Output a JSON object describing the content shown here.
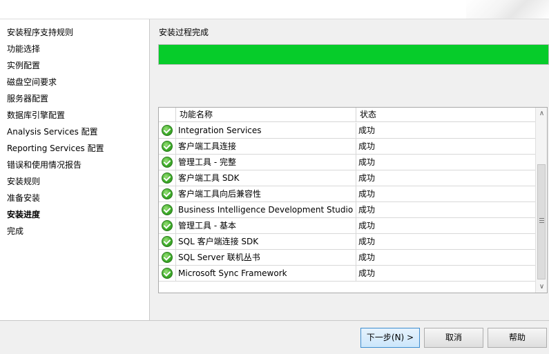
{
  "sidebar": {
    "items": [
      {
        "label": "安装程序支持规则",
        "active": false
      },
      {
        "label": "功能选择",
        "active": false
      },
      {
        "label": "实例配置",
        "active": false
      },
      {
        "label": "磁盘空间要求",
        "active": false
      },
      {
        "label": "服务器配置",
        "active": false
      },
      {
        "label": "数据库引擎配置",
        "active": false
      },
      {
        "label": "Analysis Services 配置",
        "active": false
      },
      {
        "label": "Reporting Services 配置",
        "active": false
      },
      {
        "label": "错误和使用情况报告",
        "active": false
      },
      {
        "label": "安装规则",
        "active": false
      },
      {
        "label": "准备安装",
        "active": false
      },
      {
        "label": "安装进度",
        "active": true
      },
      {
        "label": "完成",
        "active": false
      }
    ]
  },
  "main": {
    "status_text": "安装过程完成",
    "progress_fraction": 1.0,
    "progress_color": "#06cc2a",
    "table": {
      "columns": [
        "功能名称",
        "状态"
      ],
      "rows": [
        {
          "icon": "success-check-icon",
          "name": "Integration Services",
          "status": "成功"
        },
        {
          "icon": "success-check-icon",
          "name": "客户端工具连接",
          "status": "成功"
        },
        {
          "icon": "success-check-icon",
          "name": "管理工具 - 完整",
          "status": "成功"
        },
        {
          "icon": "success-check-icon",
          "name": "客户端工具 SDK",
          "status": "成功"
        },
        {
          "icon": "success-check-icon",
          "name": "客户端工具向后兼容性",
          "status": "成功"
        },
        {
          "icon": "success-check-icon",
          "name": "Business Intelligence Development Studio",
          "status": "成功"
        },
        {
          "icon": "success-check-icon",
          "name": "管理工具 - 基本",
          "status": "成功"
        },
        {
          "icon": "success-check-icon",
          "name": "SQL 客户端连接 SDK",
          "status": "成功"
        },
        {
          "icon": "success-check-icon",
          "name": "SQL Server 联机丛书",
          "status": "成功"
        },
        {
          "icon": "success-check-icon",
          "name": "Microsoft Sync Framework",
          "status": "成功"
        }
      ]
    }
  },
  "footer": {
    "next_label": "下一步(N) >",
    "cancel_label": "取消",
    "help_label": "帮助"
  }
}
